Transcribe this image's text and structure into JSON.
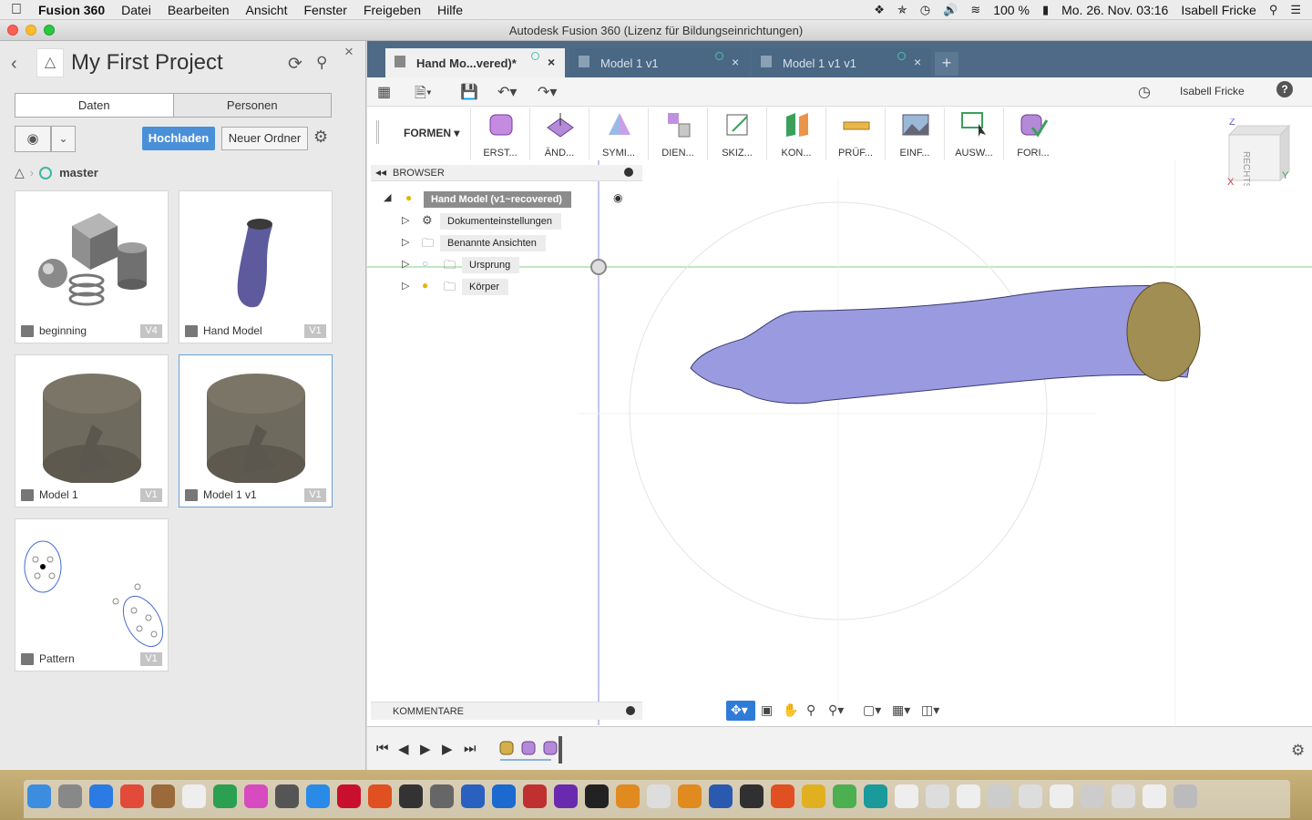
{
  "menubar": {
    "app_name": "Fusion 360",
    "items": [
      "Datei",
      "Bearbeiten",
      "Ansicht",
      "Fenster",
      "Freigeben",
      "Hilfe"
    ],
    "battery": "100 %",
    "datetime": "Mo. 26. Nov. 03:16",
    "user": "Isabell Fricke"
  },
  "window": {
    "title": "Autodesk Fusion 360 (Lizenz für Bildungseinrichtungen)"
  },
  "data_panel": {
    "project_title": "My First Project",
    "tabs": [
      "Daten",
      "Personen"
    ],
    "upload_label": "Hochladen",
    "new_folder_label": "Neuer Ordner",
    "branch": "master",
    "items": [
      {
        "name": "beginning",
        "version": "V4"
      },
      {
        "name": "Hand Model",
        "version": "V1"
      },
      {
        "name": "Model 1",
        "version": "V1"
      },
      {
        "name": "Model 1 v1",
        "version": "V1"
      },
      {
        "name": "Pattern",
        "version": "V1"
      }
    ]
  },
  "doc_tabs": [
    {
      "label": "Hand Mo...vered)*"
    },
    {
      "label": "Model 1 v1"
    },
    {
      "label": "Model 1 v1 v1"
    }
  ],
  "quickbar": {
    "user": "Isabell Fricke",
    "help": "?"
  },
  "ribbon": {
    "workspace": "FORMEN",
    "groups": [
      "ERST...",
      "ÄND...",
      "SYMI...",
      "DIEN...",
      "SKIZ...",
      "KON...",
      "PRÜF...",
      "EINF...",
      "AUSW...",
      "FORI..."
    ]
  },
  "browser": {
    "title": "BROWSER",
    "root": "Hand Model (v1~recovered)",
    "nodes": [
      "Dokumenteinstellungen",
      "Benannte Ansichten",
      "Ursprung",
      "Körper"
    ]
  },
  "comments": {
    "title": "KOMMENTARE"
  },
  "viewcube": {
    "face": "RECHTS",
    "axis_z": "Z",
    "axis_y": "Y",
    "axis_x": "X"
  },
  "colors": {
    "accent": "#4a90d9",
    "tabbar": "#4e6a86",
    "mesh": "#9a9ae0"
  }
}
